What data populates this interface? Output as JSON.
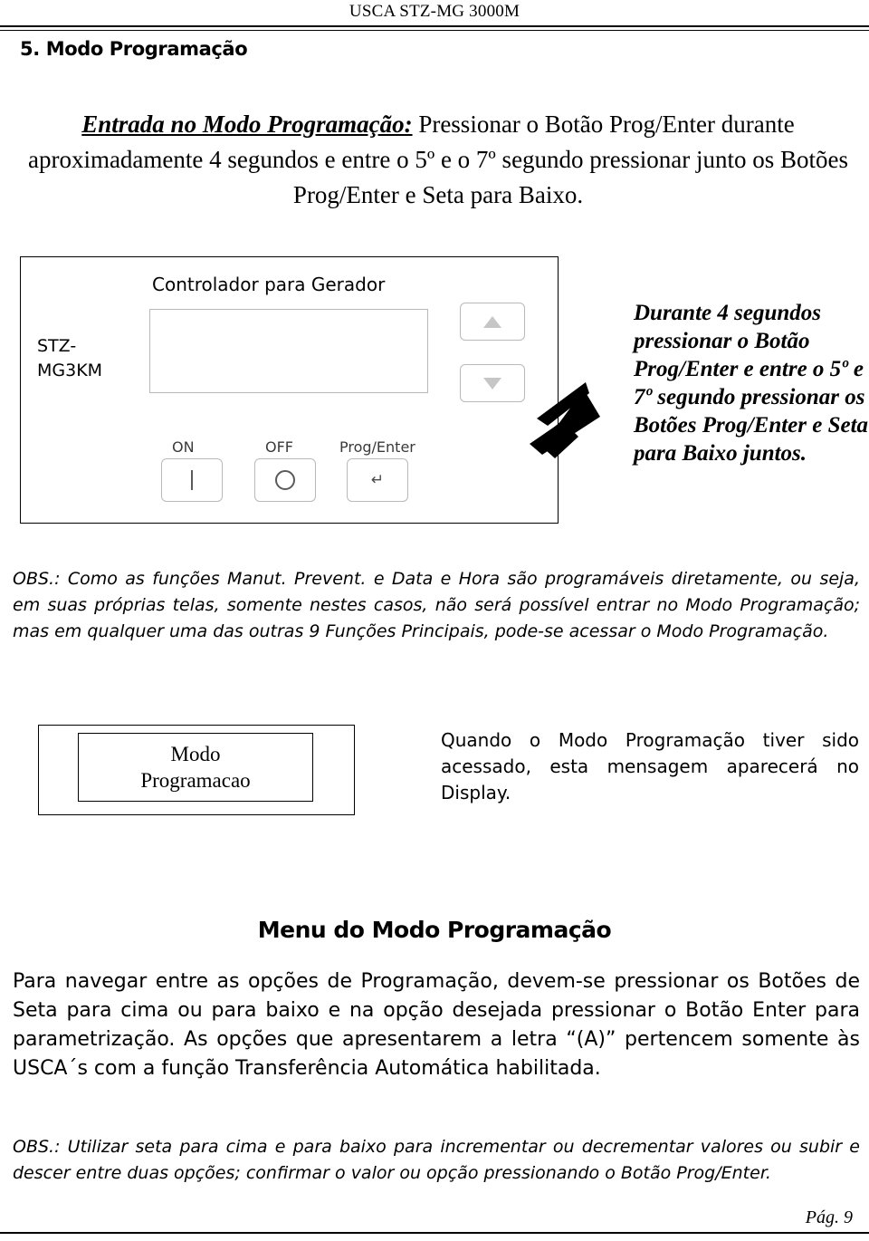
{
  "header": {
    "title": "USCA STZ-MG 3000M"
  },
  "section": {
    "number_title": "5. Modo Programação"
  },
  "intro": {
    "lead": "Entrada no Modo Programação:",
    "rest": " Pressionar o Botão Prog/Enter durante aproximadamente 4 segundos e entre o 5º e o 7º segundo pressionar junto os Botões Prog/Enter e Seta para Baixo."
  },
  "device": {
    "model_label": "STZ-\nMG3KM",
    "model_line1": "STZ-",
    "model_line2": "MG3KM",
    "heading": "Controlador para Gerador",
    "btn_on": "ON",
    "btn_off": "OFF",
    "btn_prog": "Prog/Enter",
    "icon_on": "power-on-icon",
    "icon_off": "power-off-icon",
    "icon_enter": "enter-arrow-icon",
    "icon_up": "arrow-up-icon",
    "icon_down": "arrow-down-icon"
  },
  "side_note": {
    "text": "Durante 4 segundos pressionar o Botão Prog/Enter e entre o 5º e 7º segundo pressionar os Botões Prog/Enter e Seta para Baixo juntos."
  },
  "obs_1": {
    "text": "OBS.: Como as funções Manut. Prevent. e Data e Hora são programáveis diretamente, ou seja, em suas próprias telas, somente nestes casos, não será possível entrar no Modo Programação; mas em qualquer uma das outras 9 Funções Principais, pode-se acessar o Modo Programação."
  },
  "modo_box": {
    "line1": "Modo",
    "line2": "Programacao"
  },
  "modo_note": {
    "text": "Quando o Modo Programação tiver sido acessado, esta mensagem aparecerá no Display."
  },
  "menu": {
    "heading": "Menu do Modo Programação",
    "paragraph": "Para navegar entre as opções de Programação, devem-se pressionar os Botões de Seta para cima ou para baixo e na opção desejada pressionar o Botão Enter para parametrização. As opções que apresentarem a letra “(A)” pertencem somente às USCA´s com a função Transferência Automática habilitada."
  },
  "obs_2": {
    "text": "OBS.: Utilizar seta para cima e para baixo para incrementar ou decrementar valores ou subir e descer entre duas opções; confirmar o valor ou opção pressionando o Botão Prog/Enter."
  },
  "footer": {
    "page": "Pág. 9"
  }
}
